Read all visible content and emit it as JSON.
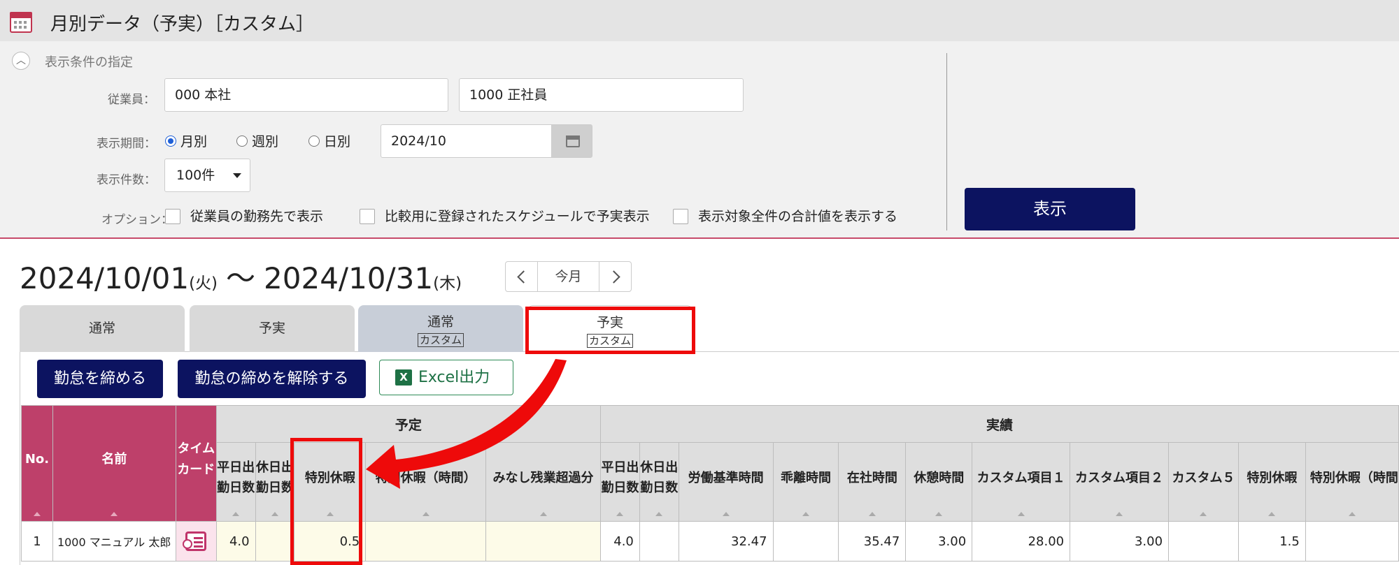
{
  "header": {
    "title": "月別データ（予実）［カスタム］"
  },
  "conditions": {
    "section_label": "表示条件の指定",
    "employee_label": "従業員：",
    "employee_org": "000 本社",
    "employee_type": "1000 正社員",
    "period_label": "表示期間：",
    "period_options": [
      "月別",
      "週別",
      "日別"
    ],
    "period_selected": "月別",
    "period_value": "2024/10",
    "count_label": "表示件数：",
    "count_value": "100件",
    "option_label": "オプション：",
    "options": [
      "従業員の勤務先で表示",
      "比較用に登録されたスケジュールで予実表示",
      "表示対象全件の合計値を表示する"
    ],
    "show_button": "表示"
  },
  "range": {
    "start": "2024/10/01",
    "start_day": "(火)",
    "tilde": "〜",
    "end": "2024/10/31",
    "end_day": "(木)",
    "today_label": "今月"
  },
  "tabs": [
    {
      "label": "通常",
      "sub": ""
    },
    {
      "label": "予実",
      "sub": ""
    },
    {
      "label": "通常",
      "sub": "カスタム"
    },
    {
      "label": "予実",
      "sub": "カスタム"
    }
  ],
  "actions": {
    "close_label": "勤怠を締める",
    "unclose_label": "勤怠の締めを解除する",
    "excel_icon": "X",
    "excel_label": "Excel出力"
  },
  "table": {
    "group_plan": "予定",
    "group_actual": "実績",
    "columns": {
      "no": "No.",
      "name": "名前",
      "timecard": "タイムカード",
      "weekday_days": "平日出勤日数",
      "holiday_days": "休日出勤日数",
      "special_leave": "特別休暇",
      "special_leave_hours": "特別休暇（時間）",
      "deemed_ot": "みなし残業超過分",
      "a_weekday_days": "平日出勤日数",
      "a_holiday_days": "休日出勤日数",
      "labor_std_hours": "労働基準時間",
      "deviation_hours": "乖離時間",
      "office_hours": "在社時間",
      "break_hours": "休憩時間",
      "custom1": "カスタム項目１",
      "custom2": "カスタム項目２",
      "custom5": "カスタム５",
      "a_special_leave": "特別休暇",
      "a_special_leave_hours": "特別休暇（時間"
    },
    "rows": [
      {
        "no": "1",
        "name": "1000 マニュアル 太郎",
        "weekday_days": "4.0",
        "holiday_days": "",
        "special_leave": "0.5",
        "special_leave_hours": "",
        "deemed_ot": "",
        "a_weekday_days": "4.0",
        "a_holiday_days": "",
        "labor_std_hours": "32.47",
        "deviation_hours": "",
        "office_hours": "35.47",
        "break_hours": "3.00",
        "custom1": "28.00",
        "custom2": "3.00",
        "custom5": "",
        "a_special_leave": "1.5",
        "a_special_leave_hours": ""
      }
    ]
  },
  "colors": {
    "brand_navy": "#0c1360",
    "header_pink": "#be406a",
    "highlight_red": "#ee0a0a",
    "excel_green": "#1e7145"
  }
}
